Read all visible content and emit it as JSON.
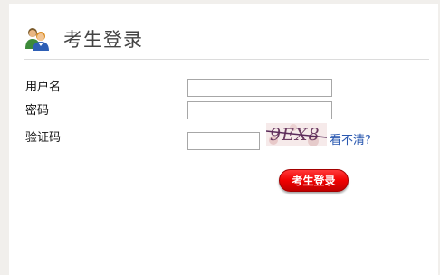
{
  "header": {
    "title": "考生登录",
    "icon": "user-group-icon"
  },
  "form": {
    "username_label": "用户名",
    "username_value": "",
    "password_label": "密码",
    "password_value": "",
    "captcha_label": "验证码",
    "captcha_value": "",
    "captcha_text": "9EX8",
    "refresh_link": "看不清?",
    "submit_label": "考生登录"
  },
  "colors": {
    "link": "#2a58b0",
    "button": "#f00000",
    "divider": "#dcdcdc",
    "side_border": "#f1efec"
  }
}
